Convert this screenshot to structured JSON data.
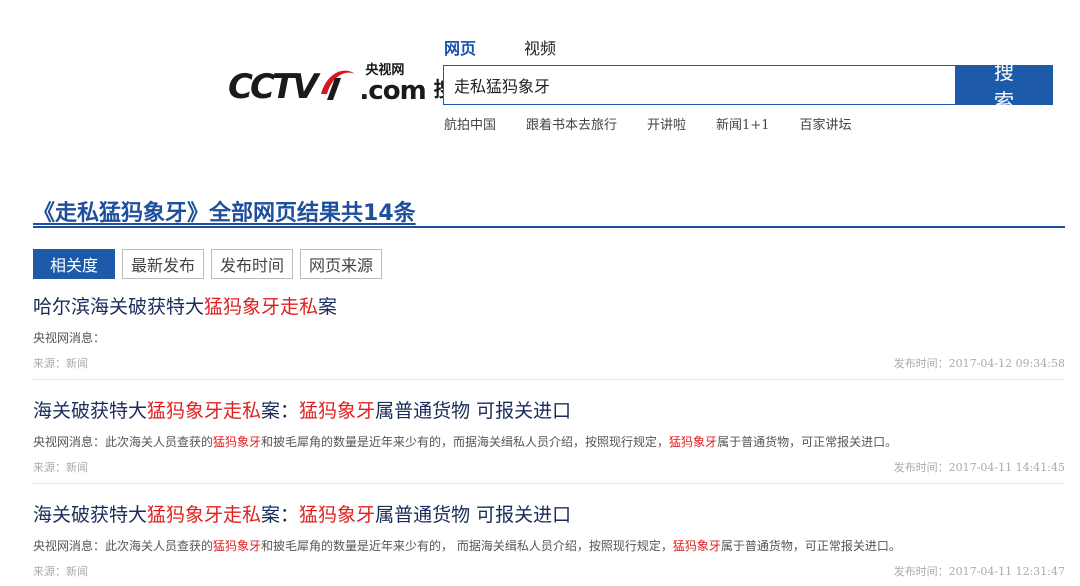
{
  "logo": {
    "brand": "CCTV",
    "cn_name": "央视网",
    "domain": ".com",
    "search_word": "搜索"
  },
  "tabs": [
    {
      "label": "网页",
      "active": true
    },
    {
      "label": "视频",
      "active": false
    }
  ],
  "search": {
    "query": "走私猛犸象牙",
    "button_label": "搜 索"
  },
  "quick_links": [
    "航拍中国",
    "跟着书本去旅行",
    "开讲啦",
    "新闻1+1",
    "百家讲坛"
  ],
  "results_heading": {
    "query_part": "《走私猛犸象牙》",
    "rest": "全部网页结果共14条"
  },
  "sort_options": [
    {
      "label": "相关度",
      "active": true
    },
    {
      "label": "最新发布",
      "active": false
    },
    {
      "label": "发布时间",
      "active": false
    },
    {
      "label": "网页来源",
      "active": false
    }
  ],
  "results": [
    {
      "title_parts": [
        {
          "text": "哈尔滨海关破获特大",
          "hl": false
        },
        {
          "text": "猛犸象牙走私",
          "hl": true
        },
        {
          "text": "案",
          "hl": false
        }
      ],
      "snippet_parts": [
        {
          "text": "央视网消息：",
          "hl": false
        }
      ],
      "source": "来源：新闻",
      "date": "发布时间：2017-04-12 09:34:58"
    },
    {
      "title_parts": [
        {
          "text": "海关破获特大",
          "hl": false
        },
        {
          "text": "猛犸象牙走私",
          "hl": true
        },
        {
          "text": "案：",
          "hl": false
        },
        {
          "text": "猛犸象牙",
          "hl": true
        },
        {
          "text": "属普通货物 可报关进口",
          "hl": false
        }
      ],
      "snippet_parts": [
        {
          "text": "央视网消息：此次海关人员查获的",
          "hl": false
        },
        {
          "text": "猛犸象牙",
          "hl": true
        },
        {
          "text": "和披毛犀角的数量是近年来少有的，而据海关缉私人员介绍，按照现行规定，",
          "hl": false
        },
        {
          "text": "猛犸象牙",
          "hl": true
        },
        {
          "text": "属于普通货物，可正常报关进口。",
          "hl": false
        }
      ],
      "source": "来源：新闻",
      "date": "发布时间：2017-04-11 14:41:45"
    },
    {
      "title_parts": [
        {
          "text": "海关破获特大",
          "hl": false
        },
        {
          "text": "猛犸象牙走私",
          "hl": true
        },
        {
          "text": "案：",
          "hl": false
        },
        {
          "text": "猛犸象牙",
          "hl": true
        },
        {
          "text": "属普通货物 可报关进口",
          "hl": false
        }
      ],
      "snippet_parts": [
        {
          "text": "央视网消息：此次海关人员查获的",
          "hl": false
        },
        {
          "text": "猛犸象牙",
          "hl": true
        },
        {
          "text": "和披毛犀角的数量是近年来少有的， 而据海关缉私人员介绍，按照现行规定，",
          "hl": false
        },
        {
          "text": "猛犸象牙",
          "hl": true
        },
        {
          "text": "属于普通货物，可正常报关进口。",
          "hl": false
        }
      ],
      "source": "来源：新闻",
      "date": "发布时间：2017-04-11 12:31:47"
    }
  ],
  "colors": {
    "brand_blue": "#1e5aaa",
    "heading_blue": "#1e4f9c",
    "highlight_red": "#e02020",
    "logo_red": "#d8171f"
  }
}
